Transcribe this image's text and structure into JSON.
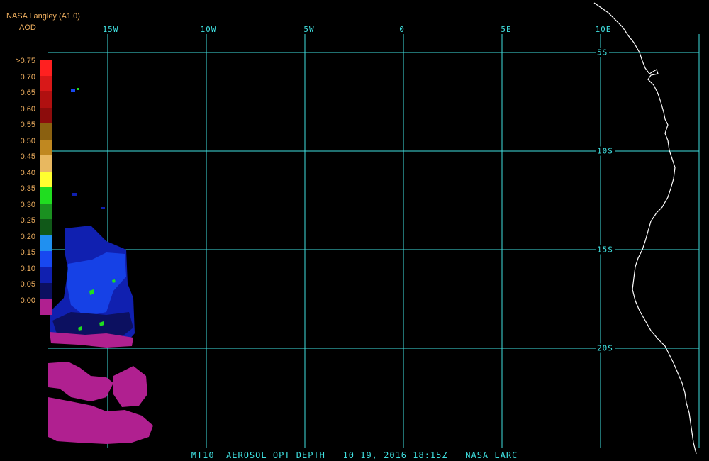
{
  "header": {
    "source": "NASA Langley (A1.0)",
    "product": "AOD"
  },
  "longitude_labels": [
    "15W",
    "10W",
    "5W",
    "0",
    "5E",
    "10E"
  ],
  "latitude_labels": [
    "5S",
    "10S",
    "15S",
    "20S"
  ],
  "legend": {
    "title": "AOD",
    "entries": [
      {
        "label": ">0.75",
        "color": "#ff2020"
      },
      {
        "label": "0.70",
        "color": "#d81818"
      },
      {
        "label": "0.65",
        "color": "#b01010"
      },
      {
        "label": "0.60",
        "color": "#8c0c0c"
      },
      {
        "label": "0.55",
        "color": "#8a6010"
      },
      {
        "label": "0.50",
        "color": "#c08820"
      },
      {
        "label": "0.45",
        "color": "#e8b860"
      },
      {
        "label": "0.40",
        "color": "#ffff30"
      },
      {
        "label": "0.35",
        "color": "#20dd20"
      },
      {
        "label": "0.30",
        "color": "#1a9020"
      },
      {
        "label": "0.25",
        "color": "#105818"
      },
      {
        "label": "0.20",
        "color": "#2090f0"
      },
      {
        "label": "0.15",
        "color": "#1848f0"
      },
      {
        "label": "0.10",
        "color": "#1020b0"
      },
      {
        "label": "0.05",
        "color": "#0c1060"
      },
      {
        "label": "0.00",
        "color": "#b02090"
      }
    ]
  },
  "colors": {
    "grid": "#40e0e0",
    "coastline": "#ffffff",
    "label": "#f0b060",
    "background": "#000000"
  },
  "footer": "MT10  AEROSOL OPT DEPTH   10 19, 2016 18:15Z   NASA LARC"
}
